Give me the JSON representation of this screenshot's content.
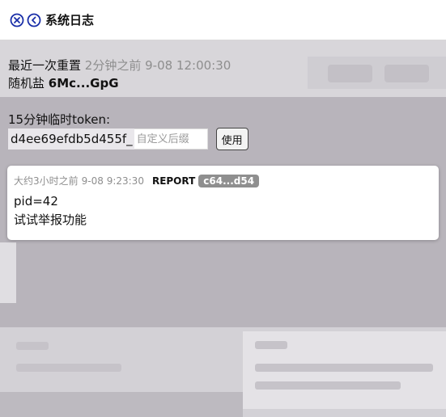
{
  "header": {
    "title": "系统日志",
    "close_icon": "close-circle-icon",
    "back_icon": "chevron-left-circle-icon",
    "accent": "#1a2fa8"
  },
  "reset": {
    "label": "最近一次重置",
    "relative": "2分钟之前",
    "timestamp": "9-08 12:00:30"
  },
  "salt": {
    "label": "随机盐",
    "value": "6Mc...GpG"
  },
  "token": {
    "label": "15分钟临时token:",
    "value": "d4ee69efdb5d455f_",
    "suffix_placeholder": "自定义后缀",
    "use_button": "使用"
  },
  "log": {
    "relative": "大约3小时之前",
    "timestamp": "9-08 9:23:30",
    "type": "REPORT",
    "hash": "c64...d54",
    "lines": [
      "pid=42",
      "试试举报功能"
    ]
  }
}
